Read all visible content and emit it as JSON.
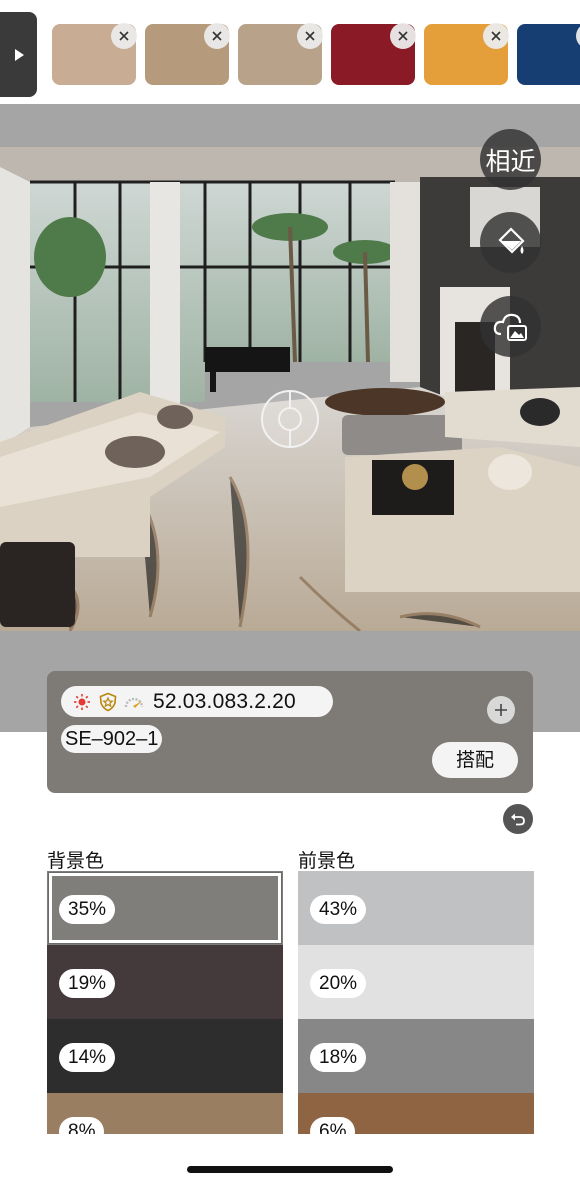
{
  "swatch_bar": {
    "expand_icon": "triangle-right-icon",
    "close_icon": "close-icon",
    "swatches": [
      {
        "color": "#c8ac94",
        "removable": true
      },
      {
        "color": "#b59a7c",
        "removable": true
      },
      {
        "color": "#b8a28a",
        "removable": true
      },
      {
        "color": "#8a1a26",
        "removable": true
      },
      {
        "color": "#e49e3a",
        "removable": true
      },
      {
        "color": "#173e73",
        "removable": true
      }
    ]
  },
  "photo_tools": {
    "similar_label": "相近",
    "fill_icon": "paint-bucket-icon",
    "cloud_image_icon": "cloud-image-icon"
  },
  "info_card": {
    "background": "#7e7b77",
    "code": "52.03.083.2.20",
    "name": "SE–902–1",
    "match_label": "搭配",
    "icons": [
      "sun-icon",
      "shield-star-icon",
      "gauge-icon"
    ]
  },
  "palettes": {
    "background": {
      "title": "背景色",
      "rows": [
        {
          "percent": "35%",
          "color": "#807e7a",
          "selected": true
        },
        {
          "percent": "19%",
          "color": "#443a3c"
        },
        {
          "percent": "14%",
          "color": "#2d2d2d"
        },
        {
          "percent": "8%",
          "color": "#9a7e62"
        }
      ]
    },
    "foreground": {
      "title": "前景色",
      "rows": [
        {
          "percent": "43%",
          "color": "#bfc1c3"
        },
        {
          "percent": "20%",
          "color": "#e1e1e1"
        },
        {
          "percent": "18%",
          "color": "#878787"
        },
        {
          "percent": "6%",
          "color": "#8e6442"
        }
      ]
    }
  }
}
